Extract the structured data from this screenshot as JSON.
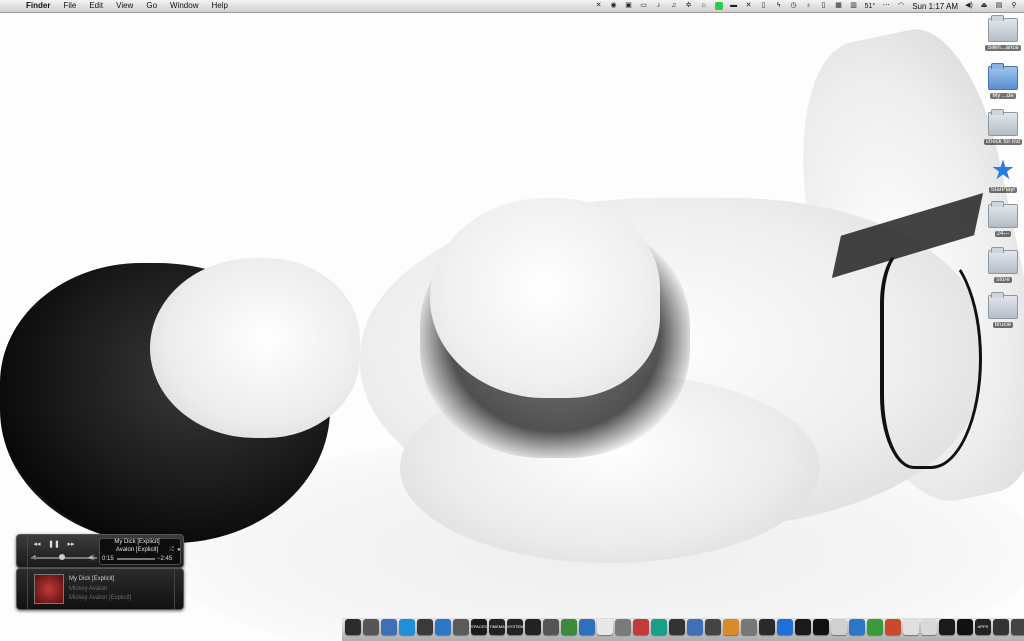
{
  "menubar": {
    "apple": "",
    "items": [
      "Finder",
      "File",
      "Edit",
      "View",
      "Go",
      "Window",
      "Help"
    ],
    "status": {
      "temperature": "51°",
      "clock": "Sun 1:17 AM"
    }
  },
  "desktop_icons": [
    {
      "label": "Silen...ance",
      "kind": "folder"
    },
    {
      "label": "My ...de",
      "kind": "folder-blue"
    },
    {
      "label": "check for ind",
      "kind": "folder"
    },
    {
      "label": "StarPlayr",
      "kind": "star"
    },
    {
      "label": "24---",
      "kind": "folder"
    },
    {
      "label": "store",
      "kind": "folder"
    },
    {
      "label": "brucie",
      "kind": "folder"
    }
  ],
  "itunes_controller": {
    "prev": "◂◂",
    "play_pause": "❚❚",
    "next": "▸▸",
    "track": "My Dick [Explicit]",
    "album": "Avalon [Explicit]",
    "elapsed": "0:15",
    "remaining": "−2:45"
  },
  "itunes_nowplaying": {
    "track": "My Dick [Explicit]",
    "artist": "Mickey Avalon",
    "album": "Mickey Avalon [Explicit]"
  },
  "dock_colors": [
    "#2b2b2b",
    "#555",
    "#3f6fb5",
    "#1f8fd6",
    "#3a3a3a",
    "#2d76c7",
    "#5a5a5a",
    "#1a1a1a",
    "#222",
    "#222",
    "#222",
    "#555",
    "#3b8a3b",
    "#2e6fc0",
    "#e8e8e8",
    "#7a7a7a",
    "#c23b3b",
    "#16a085",
    "#333",
    "#3f6fb5",
    "#444",
    "#d98a2b",
    "#777",
    "#2a2a2a",
    "#1f6fd6",
    "#1a1a1a",
    "#111",
    "#d0d0d0",
    "#2d76c7",
    "#3a9a3a",
    "#c94a2a",
    "#e0e0e0",
    "#d8d8d8",
    "#1a1a1a",
    "#111",
    "#222",
    "#333",
    "#444",
    "#555"
  ],
  "dock_labels": [
    "",
    "",
    "",
    "",
    "",
    "",
    "",
    "SPACES",
    "TIMEMA",
    "SYSTEM",
    "",
    "",
    "",
    "",
    "",
    "",
    "",
    "",
    "",
    "",
    "",
    "",
    "",
    "",
    "",
    "",
    "",
    "",
    "",
    "",
    "",
    "",
    "",
    "",
    "",
    "APPS",
    "",
    "",
    ""
  ]
}
